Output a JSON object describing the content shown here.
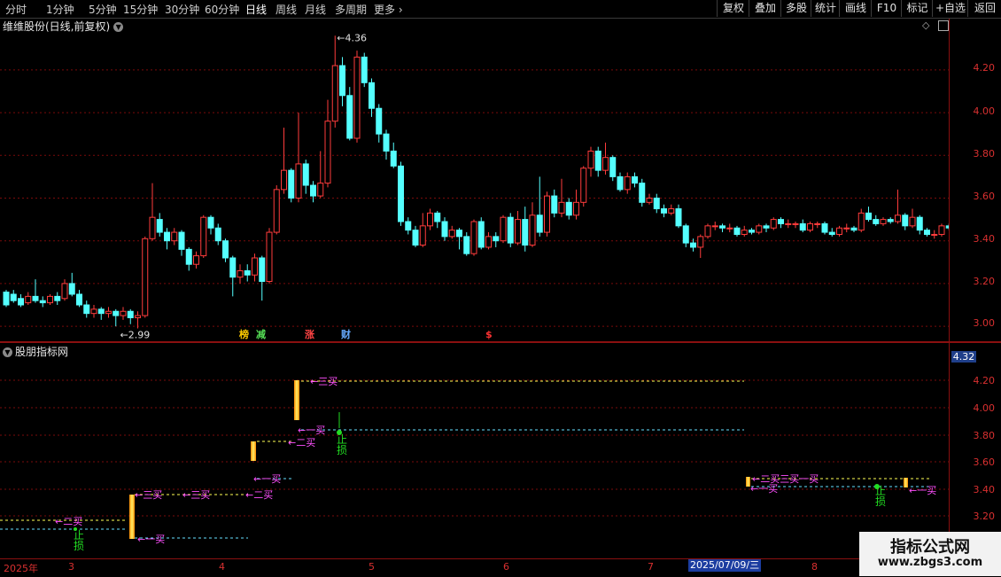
{
  "toolbar": {
    "periods": [
      "分时",
      "1分钟",
      "5分钟",
      "15分钟",
      "30分钟",
      "60分钟",
      "日线",
      "周线",
      "月线",
      "多周期",
      "更多"
    ],
    "active_period": "日线",
    "buttons": [
      "复权",
      "叠加",
      "多股",
      "统计",
      "画线",
      "F10",
      "标记",
      "+自选",
      "返回"
    ]
  },
  "main": {
    "title": "维维股份(日线,前复权)",
    "price_ticks": [
      "4.20",
      "4.00",
      "3.80",
      "3.60",
      "3.40",
      "3.20",
      "3.00"
    ],
    "high_label": "4.36",
    "low_label": "2.99",
    "events": [
      "榜",
      "减",
      "涨",
      "财",
      "$"
    ]
  },
  "indicator": {
    "title": "股朋指标网",
    "current_value": "4.32",
    "ticks": [
      "4.20",
      "4.00",
      "3.80",
      "3.60",
      "3.40",
      "3.20"
    ],
    "labels": {
      "buy1": "一买",
      "buy2": "二买",
      "buy3": "三买",
      "stop": "止损"
    }
  },
  "timeline": {
    "labels": [
      "2025年",
      "3",
      "4",
      "5",
      "6",
      "7",
      "8"
    ],
    "cursor_date": "2025/07/09/三"
  },
  "watermark": {
    "line1": "指标公式网",
    "line2": "www.zbgs3.com"
  },
  "colors": {
    "up": "#ff3c3c",
    "down": "#54ffff",
    "grid": "#7a0b0b",
    "buy": "#ff50ff",
    "stop": "#22dd22"
  },
  "chart_data": {
    "type": "candlestick",
    "ylim": [
      2.93,
      4.44
    ],
    "candles": [
      [
        3.16,
        3.1,
        3.17,
        3.09
      ],
      [
        3.15,
        3.12,
        3.17,
        3.11
      ],
      [
        3.13,
        3.1,
        3.15,
        3.09
      ],
      [
        3.11,
        3.14,
        3.16,
        3.1
      ],
      [
        3.14,
        3.12,
        3.22,
        3.11
      ],
      [
        3.12,
        3.11,
        3.14,
        3.09
      ],
      [
        3.11,
        3.14,
        3.15,
        3.1
      ],
      [
        3.14,
        3.12,
        3.16,
        3.1
      ],
      [
        3.13,
        3.2,
        3.22,
        3.12
      ],
      [
        3.2,
        3.15,
        3.25,
        3.14
      ],
      [
        3.15,
        3.1,
        3.17,
        3.09
      ],
      [
        3.1,
        3.06,
        3.12,
        3.04
      ],
      [
        3.06,
        3.08,
        3.1,
        3.04
      ],
      [
        3.08,
        3.06,
        3.09,
        3.03
      ],
      [
        3.06,
        3.07,
        3.09,
        3.04
      ],
      [
        3.07,
        3.05,
        3.08,
        3.0
      ],
      [
        3.05,
        3.07,
        3.09,
        3.03
      ],
      [
        3.07,
        3.04,
        3.08,
        3.01
      ],
      [
        3.04,
        3.05,
        3.07,
        2.99
      ],
      [
        3.05,
        3.41,
        3.42,
        3.04
      ],
      [
        3.41,
        3.51,
        3.67,
        3.4
      ],
      [
        3.5,
        3.44,
        3.53,
        3.42
      ],
      [
        3.44,
        3.4,
        3.46,
        3.36
      ],
      [
        3.4,
        3.44,
        3.46,
        3.38
      ],
      [
        3.44,
        3.36,
        3.45,
        3.33
      ],
      [
        3.36,
        3.29,
        3.37,
        3.26
      ],
      [
        3.29,
        3.33,
        3.35,
        3.27
      ],
      [
        3.33,
        3.51,
        3.52,
        3.32
      ],
      [
        3.51,
        3.46,
        3.52,
        3.43
      ],
      [
        3.46,
        3.4,
        3.48,
        3.38
      ],
      [
        3.4,
        3.32,
        3.41,
        3.3
      ],
      [
        3.32,
        3.23,
        3.33,
        3.14
      ],
      [
        3.23,
        3.26,
        3.29,
        3.2
      ],
      [
        3.26,
        3.24,
        3.29,
        3.21
      ],
      [
        3.24,
        3.32,
        3.34,
        3.21
      ],
      [
        3.32,
        3.21,
        3.33,
        3.12
      ],
      [
        3.21,
        3.44,
        3.46,
        3.2
      ],
      [
        3.44,
        3.64,
        3.66,
        3.43
      ],
      [
        3.64,
        3.73,
        3.93,
        3.62
      ],
      [
        3.73,
        3.6,
        3.74,
        3.58
      ],
      [
        3.6,
        3.76,
        4.0,
        3.58
      ],
      [
        3.76,
        3.66,
        3.78,
        3.62
      ],
      [
        3.66,
        3.61,
        3.68,
        3.58
      ],
      [
        3.61,
        3.67,
        3.82,
        3.6
      ],
      [
        3.67,
        3.96,
        4.06,
        3.65
      ],
      [
        3.96,
        4.22,
        4.36,
        3.93
      ],
      [
        4.22,
        4.08,
        4.26,
        4.03
      ],
      [
        4.08,
        3.88,
        4.12,
        3.87
      ],
      [
        3.88,
        4.26,
        4.29,
        3.86
      ],
      [
        4.26,
        4.14,
        4.28,
        4.12
      ],
      [
        4.14,
        4.02,
        4.16,
        3.98
      ],
      [
        4.02,
        3.9,
        4.04,
        3.86
      ],
      [
        3.9,
        3.82,
        3.92,
        3.78
      ],
      [
        3.82,
        3.75,
        3.86,
        3.74
      ],
      [
        3.75,
        3.49,
        3.77,
        3.47
      ],
      [
        3.49,
        3.45,
        3.51,
        3.43
      ],
      [
        3.45,
        3.38,
        3.47,
        3.37
      ],
      [
        3.38,
        3.47,
        3.53,
        3.37
      ],
      [
        3.47,
        3.53,
        3.55,
        3.45
      ],
      [
        3.53,
        3.49,
        3.54,
        3.46
      ],
      [
        3.49,
        3.42,
        3.51,
        3.4
      ],
      [
        3.42,
        3.45,
        3.47,
        3.41
      ],
      [
        3.45,
        3.42,
        3.46,
        3.36
      ],
      [
        3.42,
        3.34,
        3.44,
        3.33
      ],
      [
        3.34,
        3.49,
        3.5,
        3.33
      ],
      [
        3.49,
        3.37,
        3.51,
        3.36
      ],
      [
        3.37,
        3.42,
        3.44,
        3.36
      ],
      [
        3.42,
        3.4,
        3.44,
        3.37
      ],
      [
        3.4,
        3.51,
        3.52,
        3.39
      ],
      [
        3.51,
        3.39,
        3.53,
        3.37
      ],
      [
        3.39,
        3.5,
        3.54,
        3.38
      ],
      [
        3.5,
        3.38,
        3.56,
        3.35
      ],
      [
        3.38,
        3.52,
        3.58,
        3.37
      ],
      [
        3.52,
        3.44,
        3.7,
        3.42
      ],
      [
        3.44,
        3.61,
        3.63,
        3.42
      ],
      [
        3.61,
        3.53,
        3.64,
        3.51
      ],
      [
        3.53,
        3.58,
        3.69,
        3.51
      ],
      [
        3.58,
        3.52,
        3.6,
        3.5
      ],
      [
        3.52,
        3.58,
        3.64,
        3.5
      ],
      [
        3.58,
        3.74,
        3.75,
        3.56
      ],
      [
        3.74,
        3.82,
        3.84,
        3.7
      ],
      [
        3.82,
        3.73,
        3.84,
        3.7
      ],
      [
        3.73,
        3.79,
        3.86,
        3.71
      ],
      [
        3.79,
        3.7,
        3.8,
        3.68
      ],
      [
        3.7,
        3.64,
        3.72,
        3.63
      ],
      [
        3.64,
        3.7,
        3.72,
        3.62
      ],
      [
        3.7,
        3.67,
        3.72,
        3.65
      ],
      [
        3.67,
        3.58,
        3.69,
        3.56
      ],
      [
        3.58,
        3.6,
        3.62,
        3.57
      ],
      [
        3.6,
        3.55,
        3.62,
        3.53
      ],
      [
        3.55,
        3.53,
        3.57,
        3.51
      ],
      [
        3.53,
        3.55,
        3.57,
        3.52
      ],
      [
        3.55,
        3.47,
        3.57,
        3.46
      ],
      [
        3.47,
        3.39,
        3.48,
        3.37
      ],
      [
        3.39,
        3.37,
        3.41,
        3.35
      ],
      [
        3.37,
        3.42,
        3.43,
        3.32
      ],
      [
        3.42,
        3.47,
        3.48,
        3.41
      ],
      [
        3.47,
        3.47,
        3.49,
        3.45
      ],
      [
        3.47,
        3.46,
        3.48,
        3.44
      ],
      [
        3.46,
        3.46,
        3.48,
        3.44
      ],
      [
        3.46,
        3.43,
        3.47,
        3.42
      ],
      [
        3.43,
        3.45,
        3.47,
        3.42
      ],
      [
        3.45,
        3.44,
        3.46,
        3.43
      ],
      [
        3.44,
        3.47,
        3.48,
        3.43
      ],
      [
        3.47,
        3.46,
        3.48,
        3.44
      ],
      [
        3.46,
        3.5,
        3.51,
        3.45
      ],
      [
        3.5,
        3.48,
        3.51,
        3.46
      ],
      [
        3.48,
        3.48,
        3.5,
        3.46
      ],
      [
        3.48,
        3.48,
        3.49,
        3.46
      ],
      [
        3.48,
        3.45,
        3.5,
        3.44
      ],
      [
        3.45,
        3.48,
        3.49,
        3.44
      ],
      [
        3.48,
        3.48,
        3.49,
        3.46
      ],
      [
        3.48,
        3.44,
        3.49,
        3.43
      ],
      [
        3.44,
        3.43,
        3.46,
        3.42
      ],
      [
        3.43,
        3.46,
        3.47,
        3.42
      ],
      [
        3.46,
        3.46,
        3.48,
        3.44
      ],
      [
        3.46,
        3.45,
        3.47,
        3.44
      ],
      [
        3.45,
        3.53,
        3.55,
        3.44
      ],
      [
        3.53,
        3.5,
        3.56,
        3.49
      ],
      [
        3.5,
        3.48,
        3.52,
        3.47
      ],
      [
        3.48,
        3.5,
        3.51,
        3.47
      ],
      [
        3.5,
        3.49,
        3.51,
        3.48
      ],
      [
        3.49,
        3.52,
        3.64,
        3.48
      ],
      [
        3.52,
        3.47,
        3.53,
        3.45
      ],
      [
        3.47,
        3.51,
        3.55,
        3.46
      ],
      [
        3.51,
        3.45,
        3.52,
        3.43
      ],
      [
        3.45,
        3.43,
        3.46,
        3.42
      ],
      [
        3.43,
        3.43,
        3.45,
        3.41
      ],
      [
        3.43,
        3.47,
        3.48,
        3.42
      ],
      [
        3.47,
        3.46,
        3.48,
        3.45
      ],
      [
        3.46,
        3.44,
        3.47,
        3.43
      ],
      [
        3.44,
        3.44,
        3.46,
        3.43
      ],
      [
        3.44,
        3.45,
        3.46,
        3.44
      ],
      [
        3.45,
        3.43,
        3.46,
        3.42
      ],
      [
        3.43,
        3.39,
        3.44,
        3.38
      ],
      [
        3.39,
        3.4,
        3.41,
        3.38
      ],
      [
        3.4,
        3.42,
        3.43,
        3.39
      ],
      [
        3.42,
        3.48,
        3.51,
        3.41
      ],
      [
        3.48,
        3.46,
        3.49,
        3.45
      ],
      [
        3.46,
        3.45,
        3.47,
        3.44
      ],
      [
        3.45,
        3.49,
        3.5,
        3.43
      ]
    ]
  }
}
